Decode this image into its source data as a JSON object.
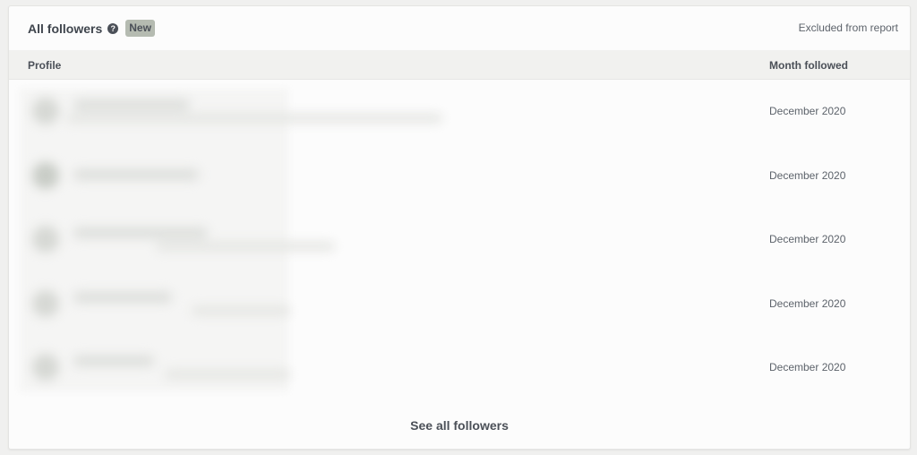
{
  "header": {
    "title": "All followers",
    "help_icon": "question-circle-icon",
    "badge": "New",
    "excluded_label": "Excluded from report"
  },
  "table": {
    "columns": [
      "Profile",
      "Month followed"
    ],
    "rows": [
      {
        "month": "December 2020"
      },
      {
        "month": "December 2020"
      },
      {
        "month": "December 2020"
      },
      {
        "month": "December 2020"
      },
      {
        "month": "December 2020"
      }
    ]
  },
  "footer": {
    "see_all_label": "See all followers"
  },
  "colors": {
    "badge_bg": "#b5bbb1",
    "header_bg": "#f1f1ef",
    "card_bg": "#fcfcfc",
    "text": "#4b5058"
  }
}
